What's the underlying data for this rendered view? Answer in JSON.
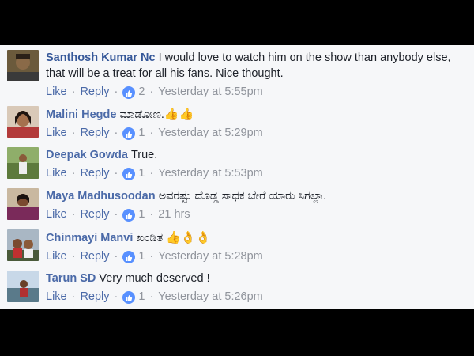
{
  "comments": [
    {
      "author": "Santhosh Kumar Nc",
      "text": "I would love to watch him on the show than anybody else, that will be a treat for all his fans. Nice thought.",
      "emoji": "",
      "like": "Like",
      "reply": "Reply",
      "reactions": "2",
      "time": "Yesterday at 5:55pm"
    },
    {
      "author": "Malini Hegde",
      "text": "ಮಾಡೋಣ.",
      "emoji": "👍👍",
      "like": "Like",
      "reply": "Reply",
      "reactions": "1",
      "time": "Yesterday at 5:29pm"
    },
    {
      "author": "Deepak Gowda",
      "text": "True.",
      "emoji": "",
      "like": "Like",
      "reply": "Reply",
      "reactions": "1",
      "time": "Yesterday at 5:53pm"
    },
    {
      "author": "Maya Madhusoodan",
      "text": "ಅವರಷ್ಟು ದೊಡ್ಡ ಸಾಧಕ ಬೇರೆ ಯಾರು ಸಿಗಲ್ಲಾ.",
      "emoji": "",
      "like": "Like",
      "reply": "Reply",
      "reactions": "1",
      "time": "21 hrs"
    },
    {
      "author": "Chinmayi Manvi",
      "text": "ಖಂಡಿತ",
      "emoji": "👍👌👌",
      "like": "Like",
      "reply": "Reply",
      "reactions": "1",
      "time": "Yesterday at 5:28pm"
    },
    {
      "author": "Tarun SD",
      "text": "Very much deserved !",
      "emoji": "",
      "like": "Like",
      "reply": "Reply",
      "reactions": "1",
      "time": "Yesterday at 5:26pm"
    }
  ],
  "colors": {
    "author": "#365899",
    "link": "#4b6aa8",
    "meta": "#90949c",
    "like_badge": "#5890ff",
    "panel_bg": "#f6f7f9",
    "frame": "#000000"
  }
}
